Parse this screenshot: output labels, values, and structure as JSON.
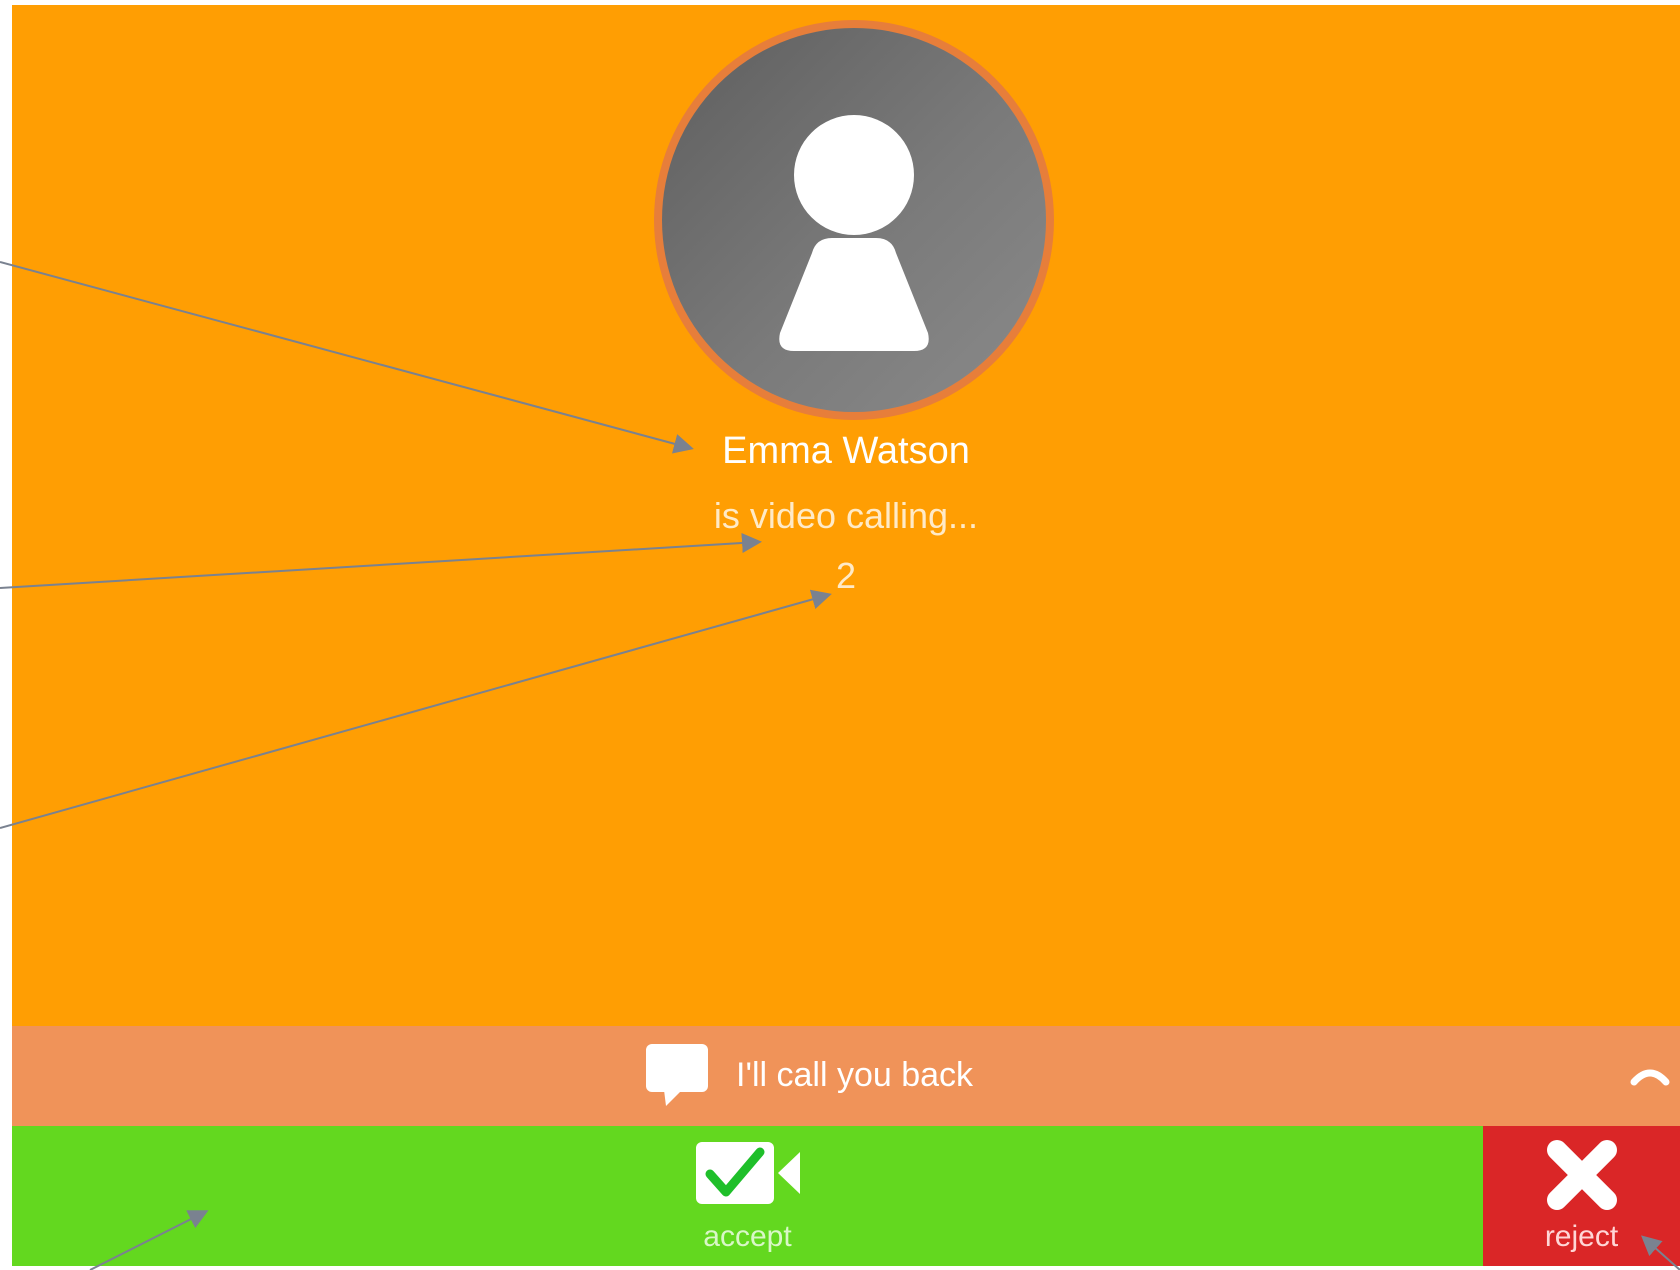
{
  "call": {
    "caller_name": "Emma Watson",
    "status": "is video calling...",
    "ring_count": "2"
  },
  "quick_reply": {
    "label": "I'll call you back",
    "icon": "speech-bubble-icon",
    "expand_icon": "chevron-up-icon"
  },
  "actions": {
    "accept_label": "accept",
    "accept_icon": "video-check-icon",
    "reject_label": "reject",
    "reject_icon": "close-x-icon"
  },
  "colors": {
    "background": "#ff9e03",
    "reply_bar": "#f09359",
    "accept": "#63d81f",
    "reject": "#da2627",
    "avatar_ring": "#e77e3a",
    "annotation_arrow": "#7a8290"
  }
}
